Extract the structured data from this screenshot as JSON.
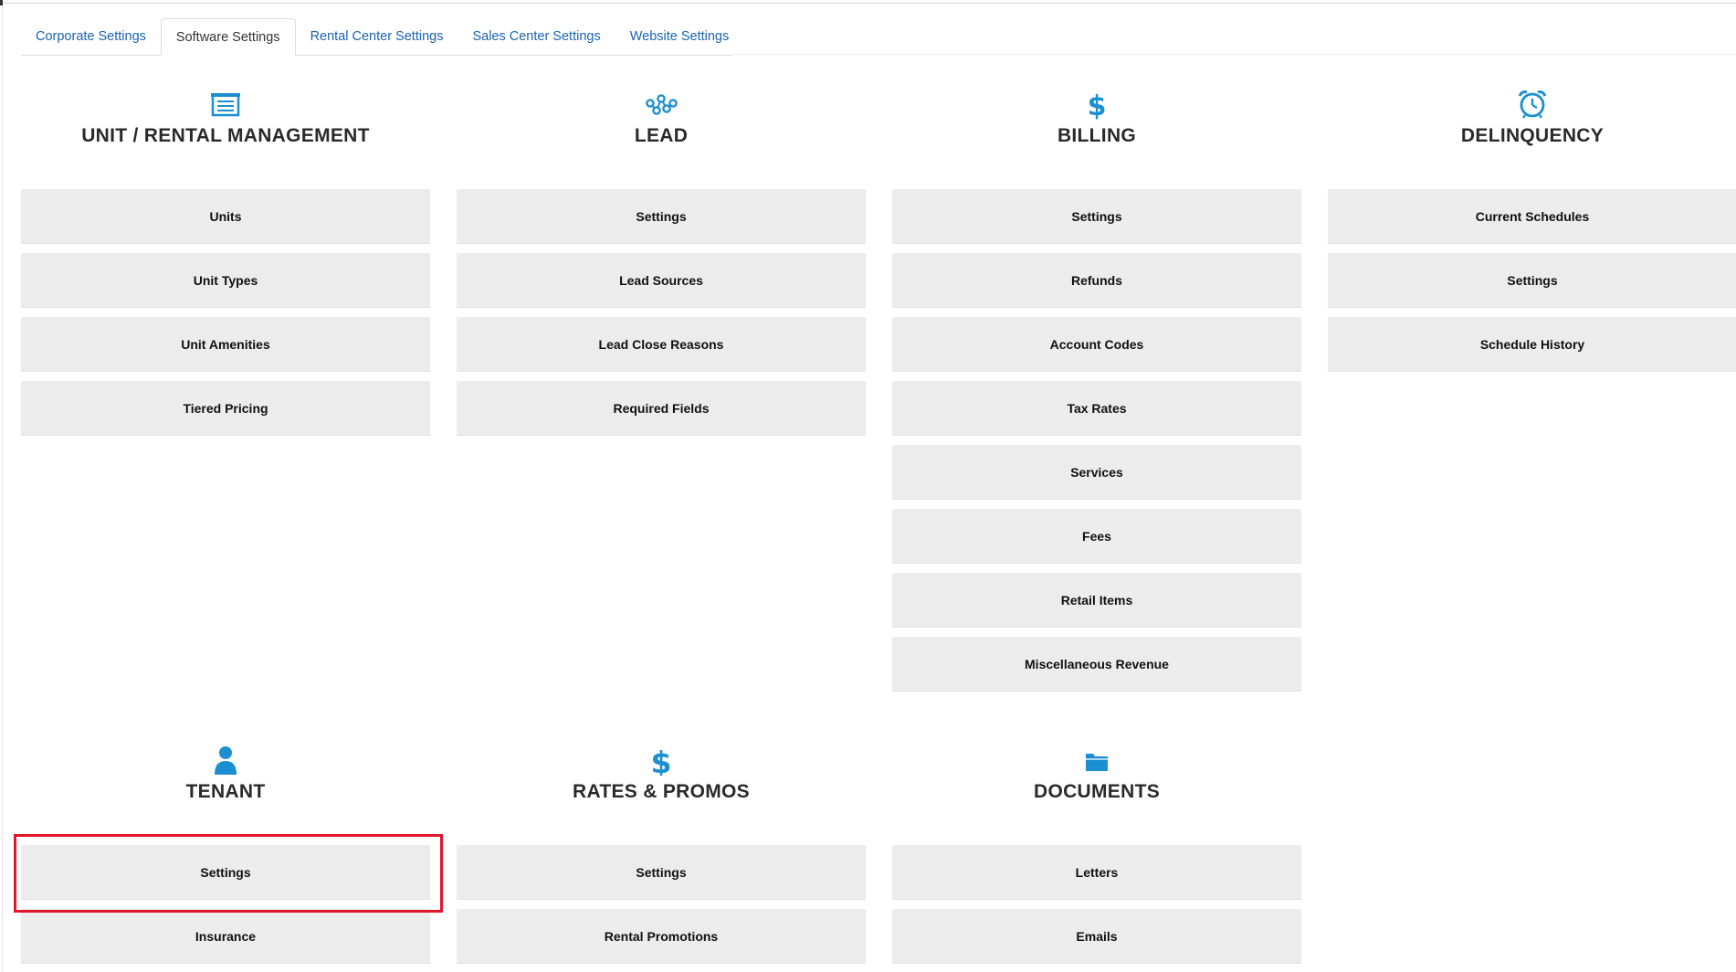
{
  "tabs": [
    {
      "label": "Corporate Settings",
      "active": false
    },
    {
      "label": "Software Settings",
      "active": true
    },
    {
      "label": "Rental Center Settings",
      "active": false
    },
    {
      "label": "Sales Center Settings",
      "active": false
    },
    {
      "label": "Website Settings",
      "active": false
    }
  ],
  "colors": {
    "accent_icon": "#1b8fd2",
    "tile_bg": "#ececec",
    "tab_link": "#1a63b0",
    "highlight": "#e0162b"
  },
  "sections": {
    "unit_rental": {
      "icon": "garage-door-icon",
      "title": "UNIT / RENTAL MANAGEMENT",
      "items": [
        "Units",
        "Unit Types",
        "Unit Amenities",
        "Tiered Pricing"
      ]
    },
    "lead": {
      "icon": "network-nodes-icon",
      "title": "LEAD",
      "items": [
        "Settings",
        "Lead Sources",
        "Lead Close Reasons",
        "Required Fields"
      ]
    },
    "billing": {
      "icon": "dollar-icon",
      "title": "BILLING",
      "items": [
        "Settings",
        "Refunds",
        "Account Codes",
        "Tax Rates",
        "Services",
        "Fees",
        "Retail Items",
        "Miscellaneous Revenue"
      ]
    },
    "delinquency": {
      "icon": "alarm-clock-icon",
      "title": "DELINQUENCY",
      "items": [
        "Current Schedules",
        "Settings",
        "Schedule History"
      ]
    },
    "tenant": {
      "icon": "person-icon",
      "title": "TENANT",
      "items": [
        "Settings",
        "Insurance"
      ]
    },
    "rates_promos": {
      "icon": "dollar-icon",
      "title": "RATES & PROMOS",
      "items": [
        "Settings",
        "Rental Promotions"
      ]
    },
    "documents": {
      "icon": "folder-icon",
      "title": "DOCUMENTS",
      "items": [
        "Letters",
        "Emails"
      ]
    }
  }
}
